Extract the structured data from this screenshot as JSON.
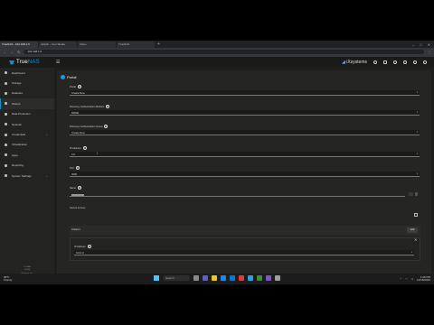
{
  "browser": {
    "tabs": [
      "TrueNAS - 192.168.1.5",
      "Jellyfin - Your Media",
      "Video",
      "TrueNAS"
    ],
    "address": "192.168.1.5"
  },
  "header": {
    "brand_prefix": "True",
    "brand_suffix": "NAS",
    "vendor": "iXsystems"
  },
  "sidebar": {
    "items": [
      {
        "label": "Dashboard",
        "icon": "dashboard-icon",
        "active": false,
        "expandable": false
      },
      {
        "label": "Storage",
        "icon": "storage-icon",
        "active": false,
        "expandable": false
      },
      {
        "label": "Datasets",
        "icon": "datasets-icon",
        "active": false,
        "expandable": false
      },
      {
        "label": "Shares",
        "icon": "shares-icon",
        "active": true,
        "expandable": false
      },
      {
        "label": "Data Protection",
        "icon": "shield-icon",
        "active": false,
        "expandable": false
      },
      {
        "label": "Network",
        "icon": "network-icon",
        "active": false,
        "expandable": false
      },
      {
        "label": "Credentials",
        "icon": "key-icon",
        "active": false,
        "expandable": true
      },
      {
        "label": "Virtualization",
        "icon": "monitor-icon",
        "active": false,
        "expandable": false
      },
      {
        "label": "Apps",
        "icon": "apps-icon",
        "active": false,
        "expandable": false
      },
      {
        "label": "Reporting",
        "icon": "chart-icon",
        "active": false,
        "expandable": false
      },
      {
        "label": "System Settings",
        "icon": "gear-icon",
        "active": false,
        "expandable": true
      }
    ],
    "footer": [
      "TrueNAS",
      "SCALE",
      "iXsystems, Inc."
    ]
  },
  "form": {
    "title": "Portal",
    "fields": {
      "portal": {
        "label": "Portal",
        "value": "Create New"
      },
      "discovery_method": {
        "label": "Discovery Authentication Method",
        "value": "NONE"
      },
      "discovery_group": {
        "label": "Discovery Authentication Group",
        "value": "Create New"
      },
      "ip_address": {
        "label": "IP Address",
        "value": "0.0"
      },
      "port": {
        "label": "Port",
        "value": "3260"
      },
      "name": {
        "label": "Name"
      },
      "secure": {
        "label": "Secure Access"
      },
      "initiators": {
        "label": "Initiators",
        "add_label": "Add"
      },
      "ip_row": {
        "label": "IP Address",
        "value": "0.0.0.0"
      }
    }
  },
  "taskbar": {
    "weather": [
      "68°F",
      "Cloudy"
    ],
    "search_placeholder": "Search",
    "time": "1:29 PM",
    "date": "10/18/2022"
  }
}
